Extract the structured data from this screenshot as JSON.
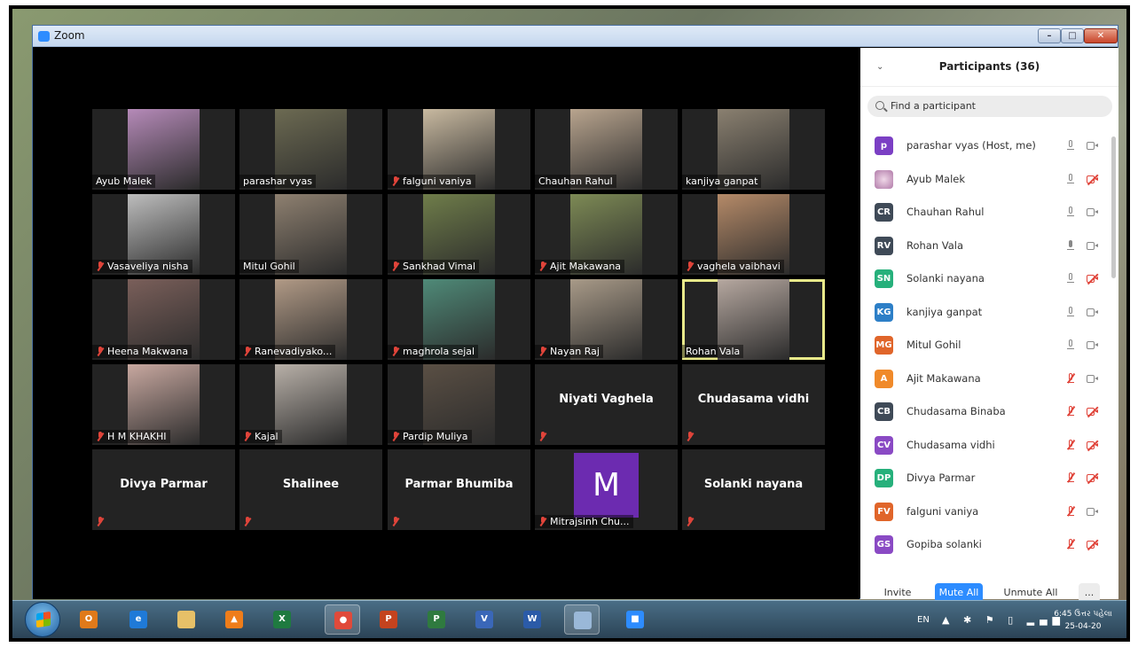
{
  "window": {
    "title": "Zoom",
    "min": "–",
    "max": "□",
    "close": "✕"
  },
  "tiles": [
    {
      "name": "Ayub Malek",
      "muted": false,
      "type": "photo",
      "photo_color": "#b58ab8"
    },
    {
      "name": "parashar vyas",
      "muted": false,
      "type": "photo",
      "photo_color": "#6c6a52"
    },
    {
      "name": "falguni vaniya",
      "muted": true,
      "type": "photo",
      "photo_color": "#c8b9a0"
    },
    {
      "name": "Chauhan Rahul",
      "muted": false,
      "type": "photo",
      "photo_color": "#b8a48e"
    },
    {
      "name": "kanjiya ganpat",
      "muted": false,
      "type": "photo",
      "photo_color": "#8a8070"
    },
    {
      "name": "Vasaveliya nisha",
      "muted": true,
      "type": "photo",
      "photo_color": "#bdbdbd"
    },
    {
      "name": "Mitul Gohil",
      "muted": false,
      "type": "photo",
      "photo_color": "#8e8070"
    },
    {
      "name": "Sankhad Vimal",
      "muted": true,
      "type": "photo",
      "photo_color": "#6f7d4a"
    },
    {
      "name": "Ajit Makawana",
      "muted": true,
      "type": "photo",
      "photo_color": "#7d8a55"
    },
    {
      "name": "vaghela vaibhavi",
      "muted": true,
      "type": "photo",
      "photo_color": "#b58a68"
    },
    {
      "name": "Heena Makwana",
      "muted": true,
      "type": "photo",
      "photo_color": "#7a5f5a"
    },
    {
      "name": "Ranevadiyako...",
      "muted": true,
      "type": "photo",
      "photo_color": "#b19a86"
    },
    {
      "name": "maghrola sejal",
      "muted": true,
      "type": "photo",
      "photo_color": "#4f8a78"
    },
    {
      "name": "Nayan Raj",
      "muted": true,
      "type": "photo",
      "photo_color": "#a89a88"
    },
    {
      "name": "Rohan Vala",
      "muted": false,
      "type": "photo",
      "photo_color": "#b6a8a0",
      "active": true
    },
    {
      "name": "H M KHAKHI",
      "muted": true,
      "type": "photo",
      "photo_color": "#c8a8a0"
    },
    {
      "name": "Kajal",
      "muted": true,
      "type": "photo",
      "photo_color": "#b8b0a8"
    },
    {
      "name": "Pardip Muliya",
      "muted": true,
      "type": "photo",
      "photo_color": "#5a4f44"
    },
    {
      "name": "Niyati Vaghela",
      "muted": true,
      "type": "name"
    },
    {
      "name": "Chudasama vidhi",
      "muted": true,
      "type": "name"
    },
    {
      "name": "Divya Parmar",
      "muted": true,
      "type": "name"
    },
    {
      "name": "Shalinee",
      "muted": true,
      "type": "name"
    },
    {
      "name": "Parmar Bhumiba",
      "muted": true,
      "type": "name"
    },
    {
      "name": "Mitrajsinh Chu...",
      "muted": true,
      "type": "avatar",
      "letter": "M"
    },
    {
      "name": "Solanki nayana",
      "muted": true,
      "type": "name"
    }
  ],
  "panel": {
    "title": "Participants (36)",
    "search_placeholder": "Find a participant",
    "participants": [
      {
        "initials": "p",
        "name": "parashar vyas (Host, me)",
        "color": "#7b3fc4",
        "mic": "off",
        "cam": "on"
      },
      {
        "initials": "",
        "name": "Ayub Malek",
        "color": "#c090c0",
        "mic": "off",
        "cam": "off",
        "photo": true
      },
      {
        "initials": "CR",
        "name": "Chauhan Rahul",
        "color": "#3f4a57",
        "mic": "off",
        "cam": "on"
      },
      {
        "initials": "RV",
        "name": "Rohan Vala",
        "color": "#3f4a57",
        "mic": "on",
        "cam": "on"
      },
      {
        "initials": "SN",
        "name": "Solanki nayana",
        "color": "#26b07b",
        "mic": "off",
        "cam": "off"
      },
      {
        "initials": "KG",
        "name": "kanjiya ganpat",
        "color": "#2d7fc7",
        "mic": "off",
        "cam": "on"
      },
      {
        "initials": "MG",
        "name": "Mitul Gohil",
        "color": "#e0652a",
        "mic": "off",
        "cam": "on"
      },
      {
        "initials": "A",
        "name": "Ajit Makawana",
        "color": "#f08a2a",
        "mic": "muted",
        "cam": "on"
      },
      {
        "initials": "CB",
        "name": "Chudasama Binaba",
        "color": "#3f4a57",
        "mic": "muted",
        "cam": "off"
      },
      {
        "initials": "CV",
        "name": "Chudasama vidhi",
        "color": "#8a4ac4",
        "mic": "muted",
        "cam": "off"
      },
      {
        "initials": "DP",
        "name": "Divya Parmar",
        "color": "#26b07b",
        "mic": "muted",
        "cam": "off"
      },
      {
        "initials": "FV",
        "name": "falguni vaniya",
        "color": "#e0652a",
        "mic": "muted",
        "cam": "on"
      },
      {
        "initials": "GS",
        "name": "Gopiba solanki",
        "color": "#8a4ac4",
        "mic": "muted",
        "cam": "off"
      }
    ],
    "buttons": {
      "invite": "Invite",
      "mute_all": "Mute All",
      "unmute_all": "Unmute All",
      "more": "..."
    }
  },
  "taskbar": {
    "apps": [
      {
        "name": "outlook-icon",
        "label": "O",
        "color": "#e07a1a"
      },
      {
        "name": "internet-explorer-icon",
        "label": "e",
        "color": "#1f7ad8"
      },
      {
        "name": "file-explorer-icon",
        "label": "",
        "color": "#e6c068"
      },
      {
        "name": "vlc-icon",
        "label": "▲",
        "color": "#ef7d1a"
      },
      {
        "name": "excel-icon",
        "label": "X",
        "color": "#1f7a40"
      },
      {
        "name": "chrome-icon",
        "label": "●",
        "color": "#e04a3a"
      },
      {
        "name": "powerpoint-icon",
        "label": "P",
        "color": "#c4431e"
      },
      {
        "name": "project-icon",
        "label": "P",
        "color": "#2f7a3f"
      },
      {
        "name": "visio-icon",
        "label": "V",
        "color": "#3a67b8"
      },
      {
        "name": "word-icon",
        "label": "W",
        "color": "#2b5ba8"
      },
      {
        "name": "paint-icon",
        "label": "",
        "color": "#9ab8d8"
      },
      {
        "name": "zoom-icon",
        "label": "■",
        "color": "#2d8cff"
      }
    ],
    "lang": "EN",
    "time": "6:45 ઉત્તર પહેલા",
    "date": "25-04-20"
  }
}
